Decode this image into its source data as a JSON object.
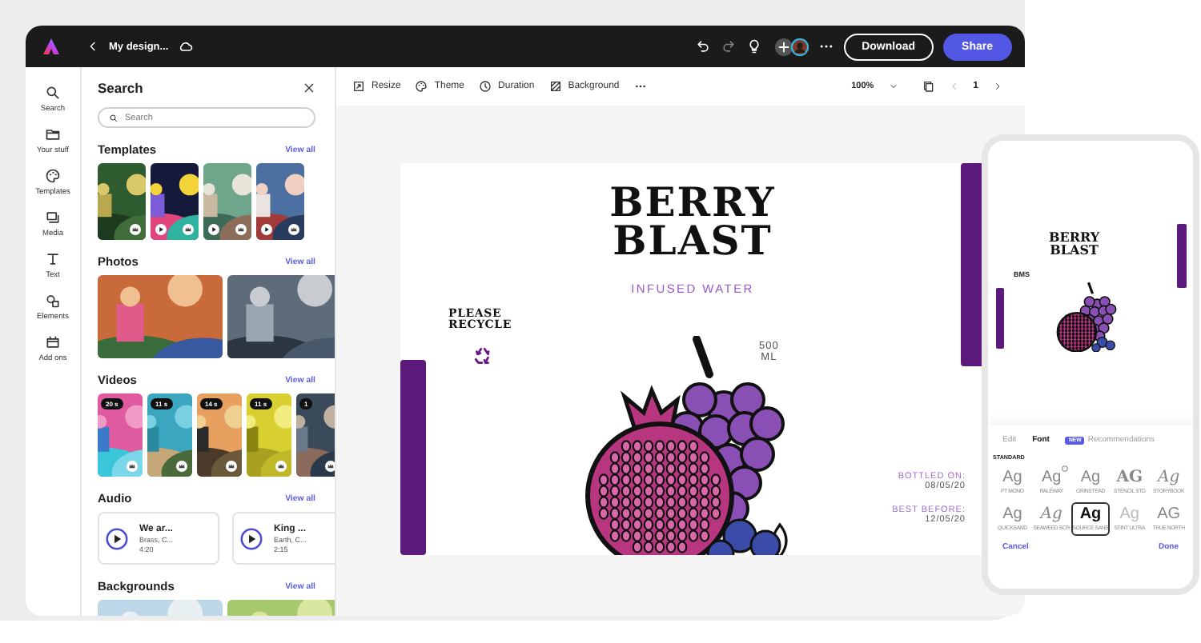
{
  "topbar": {
    "title": "My design...",
    "buttons": [
      {
        "label": "Download",
        "kind": "outline"
      },
      {
        "label": "Share",
        "kind": "primary"
      }
    ]
  },
  "rail": [
    {
      "label": "Search",
      "kind": "search"
    },
    {
      "label": "Your stuff",
      "kind": "folder"
    },
    {
      "label": "Templates",
      "kind": "palette"
    },
    {
      "label": "Media",
      "kind": "media"
    },
    {
      "label": "Text",
      "kind": "text"
    },
    {
      "label": "Elements",
      "kind": "shapes"
    },
    {
      "label": "Add ons",
      "kind": "addons"
    }
  ],
  "panel": {
    "title": "Search",
    "search": {
      "placeholder": "Search"
    },
    "templates": {
      "title": "Templates",
      "link": "View all",
      "items": [
        {
          "video": false
        },
        {
          "video": true
        },
        {
          "video": true
        },
        {
          "video": true
        }
      ]
    },
    "photos": {
      "title": "Photos",
      "link": "View all"
    },
    "videos": {
      "title": "Videos",
      "link": "View all",
      "items": [
        {
          "duration": "20 s"
        },
        {
          "duration": "11 s"
        },
        {
          "duration": "14 s"
        },
        {
          "duration": "11 s"
        },
        {
          "duration": "1"
        }
      ]
    },
    "audio": {
      "title": "Audio",
      "link": "View all",
      "items": [
        {
          "title": "We ar...",
          "artist": "Brass, C...",
          "time": "4:20"
        },
        {
          "title": "King ...",
          "artist": "Earth, C...",
          "time": "2:15"
        }
      ]
    },
    "backgrounds": {
      "title": "Backgrounds",
      "link": "View all"
    }
  },
  "toolbar": {
    "items": [
      {
        "label": "Resize",
        "kind": "resize"
      },
      {
        "label": "Theme",
        "kind": "theme"
      },
      {
        "label": "Duration",
        "kind": "duration"
      },
      {
        "label": "Background",
        "kind": "background"
      }
    ],
    "zoom": "100%",
    "page": "1"
  },
  "design": {
    "title_lines": [
      "BERRY",
      "BLAST"
    ],
    "subtitle": "INFUSED WATER",
    "recycle_lines": [
      "PLEASE",
      "RECYCLE"
    ],
    "volume_lines": [
      "500",
      "ML"
    ],
    "dates": [
      {
        "label": "BOTTLED ON:",
        "value": "08/05/20"
      },
      {
        "label": "BEST BEFORE:",
        "value": "12/05/20"
      }
    ]
  },
  "phone": {
    "design": {
      "title_lines": [
        "BERRY",
        "BLAST"
      ],
      "tag": "BMS"
    },
    "tabs": [
      {
        "label": "Edit",
        "selected": false
      },
      {
        "label": "Font",
        "selected": true
      },
      {
        "label": "Recommendations",
        "selected": false,
        "badge": "NEW"
      }
    ],
    "section": "STANDARD",
    "fonts": [
      {
        "sample": "Ag",
        "name": "PT MONO",
        "kind": "sans",
        "selected": false,
        "downloadable": false
      },
      {
        "sample": "Ag",
        "name": "RALEWAY",
        "kind": "sans",
        "selected": false,
        "downloadable": true
      },
      {
        "sample": "Ag",
        "name": "GRINSTEAD",
        "kind": "sans",
        "selected": false,
        "downloadable": false
      },
      {
        "sample": "AG",
        "name": "STENCIL STD",
        "kind": "stencil",
        "selected": false,
        "downloadable": false
      },
      {
        "sample": "Ag",
        "name": "STORYBOOK",
        "kind": "script",
        "selected": false,
        "downloadable": false
      },
      {
        "sample": "Ag",
        "name": "QUICKSAND",
        "kind": "sans",
        "selected": false,
        "downloadable": false
      },
      {
        "sample": "Ag",
        "name": "SEAWEED SCR",
        "kind": "script",
        "selected": false,
        "downloadable": false
      },
      {
        "sample": "Ag",
        "name": "SOURCE SANS",
        "kind": "bold",
        "selected": true,
        "downloadable": false
      },
      {
        "sample": "Ag",
        "name": "STINT ULTRA",
        "kind": "light",
        "selected": false,
        "downloadable": false
      },
      {
        "sample": "AG",
        "name": "TRUE NORTH",
        "kind": "sans",
        "selected": false,
        "downloadable": false
      }
    ],
    "actions": [
      "Cancel",
      "Done"
    ]
  }
}
